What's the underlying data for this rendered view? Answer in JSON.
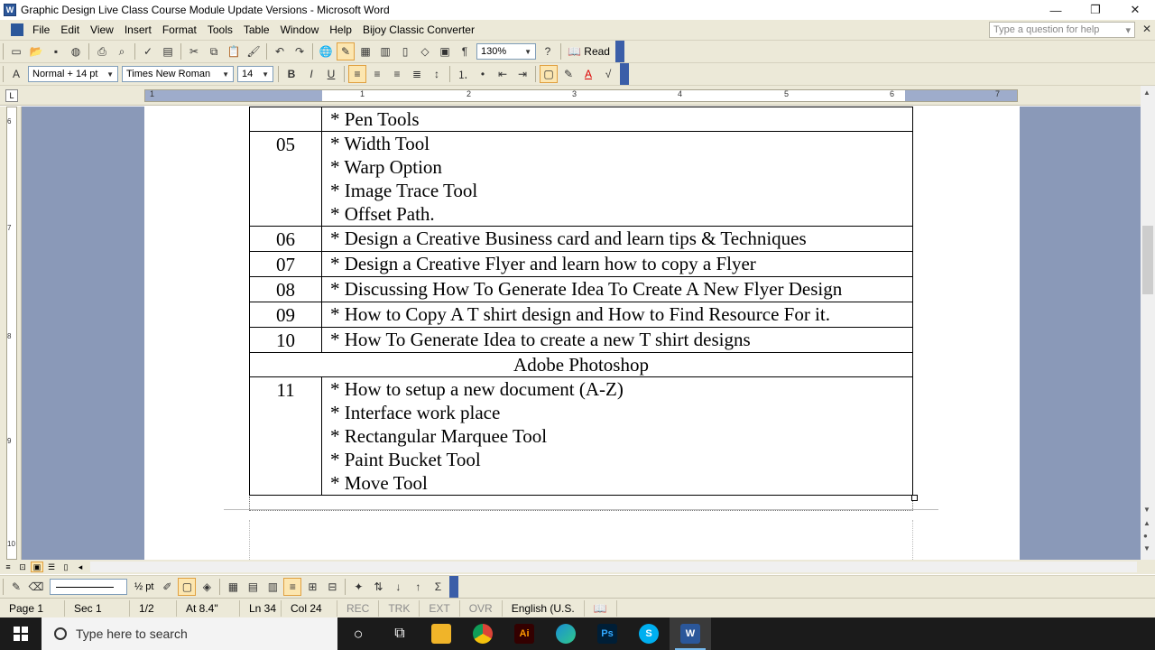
{
  "window": {
    "title": "Graphic Design Live Class Course Module Update Versions - Microsoft Word",
    "app_icon_letter": "W",
    "minimize": "—",
    "restore": "❐",
    "close": "✕"
  },
  "menu": {
    "items": [
      "File",
      "Edit",
      "View",
      "Insert",
      "Format",
      "Tools",
      "Table",
      "Window",
      "Help",
      "Bijoy Classic Converter"
    ],
    "help_placeholder": "Type a question for help",
    "close_doc": "✕"
  },
  "toolbar_standard": {
    "zoom": "130%",
    "read_label": "Read"
  },
  "toolbar_formatting": {
    "style": "Normal + 14 pt",
    "font": "Times New Roman",
    "size": "14",
    "bold": "B",
    "italic": "I",
    "underline": "U"
  },
  "ruler": {
    "numbers": [
      "1",
      "1",
      "2",
      "3",
      "4",
      "5",
      "6",
      "7"
    ]
  },
  "vertical_ruler": {
    "numbers": [
      "6",
      "7",
      "8",
      "9",
      "10"
    ]
  },
  "document": {
    "top_row": {
      "num": "",
      "lines": [
        "* Pen Tools"
      ]
    },
    "rows": [
      {
        "num": "05",
        "lines": [
          "* Width Tool",
          "* Warp Option",
          "* Image Trace Tool",
          "* Offset Path."
        ]
      },
      {
        "num": "06",
        "lines": [
          "* Design a Creative Business card and learn tips & Techniques"
        ]
      },
      {
        "num": "07",
        "lines": [
          "* Design a Creative Flyer and learn how to copy a Flyer"
        ]
      },
      {
        "num": "08",
        "lines": [
          "* Discussing How To Generate Idea To Create A New Flyer Design"
        ]
      },
      {
        "num": "09",
        "lines": [
          "* How to Copy A T shirt design and How to Find Resource For it."
        ]
      },
      {
        "num": "10",
        "lines": [
          "* How To Generate Idea to create a new T shirt designs"
        ]
      }
    ],
    "section_header": "Adobe Photoshop",
    "rows_after": [
      {
        "num": "11",
        "lines": [
          "* How to setup a new document (A-Z)",
          "* Interface work place",
          "* Rectangular Marquee Tool",
          "* Paint Bucket Tool",
          "* Move Tool"
        ]
      }
    ]
  },
  "drawing_toolbar": {
    "line_weight": "½ pt"
  },
  "status": {
    "page": "Page 1",
    "section": "Sec 1",
    "page_of": "1/2",
    "at": "At 8.4\"",
    "line": "Ln 34",
    "col": "Col 24",
    "rec": "REC",
    "trk": "TRK",
    "ext": "EXT",
    "ovr": "OVR",
    "language": "English (U.S."
  },
  "taskbar": {
    "search_placeholder": "Type here to search",
    "apps": [
      {
        "name": "cortana",
        "glyph": "○",
        "color": "#1b1b1b"
      },
      {
        "name": "task-view",
        "glyph": "⧉",
        "color": "#1b1b1b"
      },
      {
        "name": "file-explorer",
        "glyph": "",
        "color": "#f0b429"
      },
      {
        "name": "chrome",
        "glyph": "",
        "color": "#db4437"
      },
      {
        "name": "illustrator",
        "glyph": "Ai",
        "color": "#ff7c00"
      },
      {
        "name": "edge",
        "glyph": "",
        "color": "#1a8fd6"
      },
      {
        "name": "photoshop",
        "glyph": "Ps",
        "color": "#31a8ff"
      },
      {
        "name": "skype",
        "glyph": "S",
        "color": "#00aff0"
      },
      {
        "name": "word",
        "glyph": "W",
        "color": "#2b579a"
      }
    ]
  }
}
